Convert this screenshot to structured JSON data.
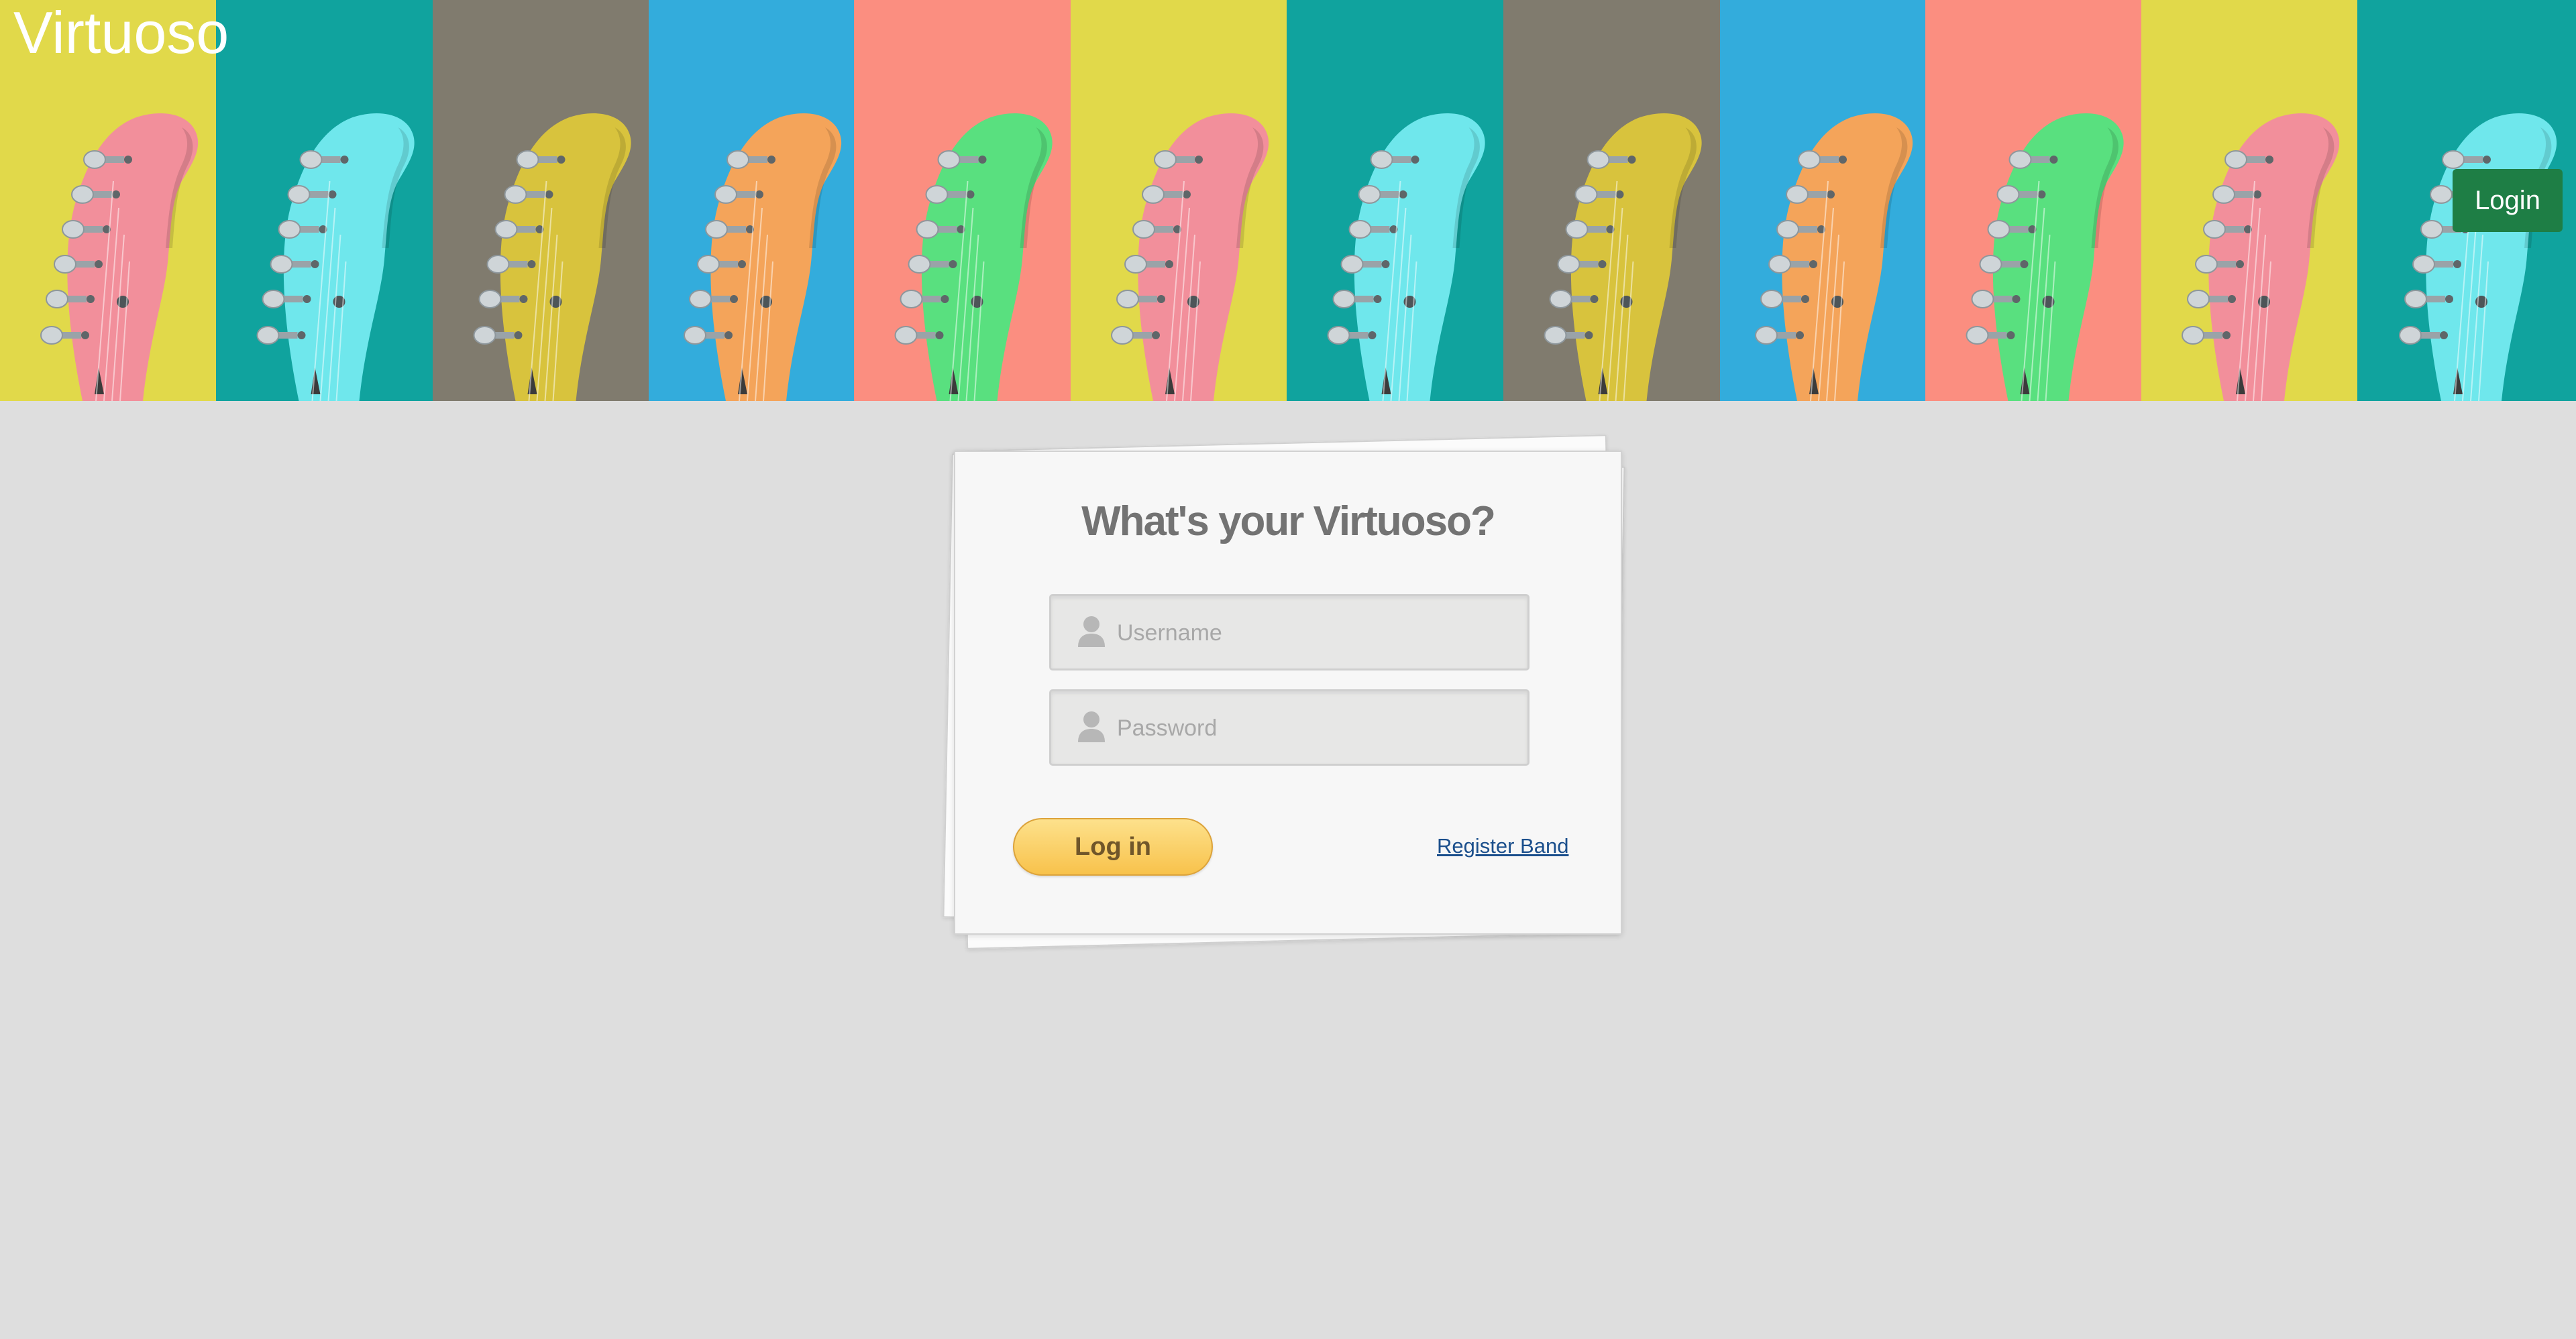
{
  "app": {
    "brand": "Virtuoso"
  },
  "header": {
    "login_label": "Login"
  },
  "banner": {
    "panels": [
      {
        "bg": "#e1d94a",
        "guitar": "#f28f9b"
      },
      {
        "bg": "#10a39e",
        "guitar": "#6fe7ec"
      },
      {
        "bg": "#807b6e",
        "guitar": "#d8c33d"
      },
      {
        "bg": "#33acdc",
        "guitar": "#f4a45a"
      },
      {
        "bg": "#fb8e80",
        "guitar": "#59e07f"
      },
      {
        "bg": "#e1d94a",
        "guitar": "#f28f9b"
      },
      {
        "bg": "#10a39e",
        "guitar": "#6fe7ec"
      },
      {
        "bg": "#807b6e",
        "guitar": "#d8c33d"
      },
      {
        "bg": "#33acdc",
        "guitar": "#f4a45a"
      },
      {
        "bg": "#fb8e80",
        "guitar": "#59e07f"
      },
      {
        "bg": "#e1d94a",
        "guitar": "#f28f9b"
      },
      {
        "bg": "#10a39e",
        "guitar": "#6fe7ec"
      }
    ]
  },
  "login_card": {
    "title": "What's your Virtuoso?",
    "username_placeholder": "Username",
    "password_placeholder": "Password",
    "submit_label": "Log in",
    "register_link": "Register Band"
  },
  "colors": {
    "page_bg": "#dedede",
    "login_button": "#1e7e45",
    "submit_button": "#f8c24b",
    "link": "#1b4f8c"
  }
}
